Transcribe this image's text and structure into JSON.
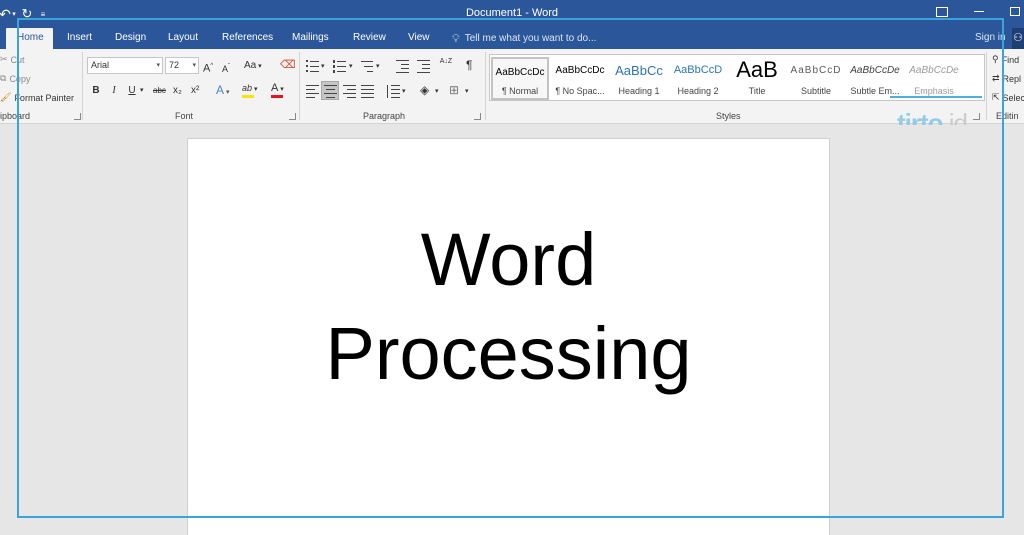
{
  "window": {
    "title": "Document1 - Word",
    "qat": {
      "undo_icon": "undo-icon",
      "redo_icon": "redo-icon",
      "customize_icon": "customize-qat-icon"
    }
  },
  "tabs": [
    {
      "label": "Home",
      "active": true
    },
    {
      "label": "Insert"
    },
    {
      "label": "Design"
    },
    {
      "label": "Layout"
    },
    {
      "label": "References"
    },
    {
      "label": "Mailings"
    },
    {
      "label": "Review"
    },
    {
      "label": "View"
    }
  ],
  "tellme": {
    "placeholder": "Tell me what you want to do..."
  },
  "account": {
    "signin_label": "Sign in"
  },
  "clipboard": {
    "group_label": "ipboard",
    "cut": "Cut",
    "copy": "Copy",
    "format_painter": "Format Painter"
  },
  "font": {
    "group_label": "Font",
    "family": "Arial",
    "size": "72",
    "grow": "A",
    "shrink": "A",
    "change_case": "Aa",
    "bold": "B",
    "italic": "I",
    "underline": "U",
    "strikethrough": "abc",
    "subscript": "x₂",
    "superscript": "x²",
    "text_effects": "A",
    "highlight": "ab",
    "font_color": "A",
    "font_color_value": "#e81123",
    "highlight_color_value": "#f5e600"
  },
  "paragraph": {
    "group_label": "Paragraph",
    "sort": "A↓Z",
    "show_marks": "¶"
  },
  "styles": {
    "group_label": "Styles",
    "items": [
      {
        "preview": "AaBbCcDc",
        "name": "¶ Normal",
        "selected": true
      },
      {
        "preview": "AaBbCcDc",
        "name": "¶ No Spac..."
      },
      {
        "preview": "AaBbCc",
        "name": "Heading 1"
      },
      {
        "preview": "AaBbCcD",
        "name": "Heading 2"
      },
      {
        "preview": "AaB",
        "name": "Title"
      },
      {
        "preview": "AaBbCcD",
        "name": "Subtitle"
      },
      {
        "preview": "AaBbCcDe",
        "name": "Subtle Em..."
      },
      {
        "preview": "AaBbCcDe",
        "name": "Emphasis"
      }
    ]
  },
  "editing": {
    "group_label": "Editin",
    "find": "Find",
    "replace": "Repl",
    "select": "Selec"
  },
  "watermark": {
    "main": "tirto",
    "suffix": ".id"
  },
  "document": {
    "lines": [
      "Word",
      "Processing"
    ]
  }
}
